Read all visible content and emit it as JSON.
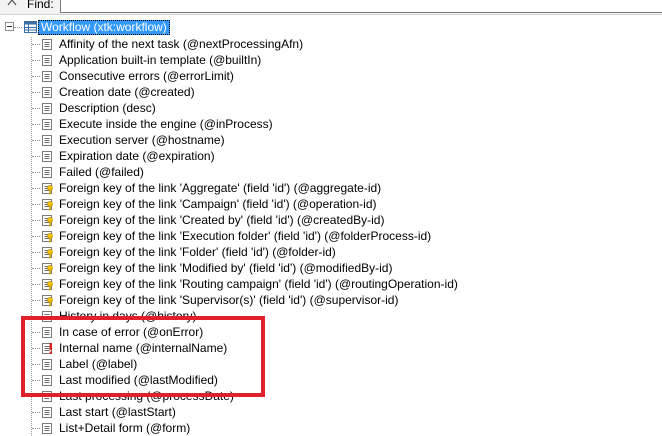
{
  "findbar": {
    "label": "Find:",
    "value": ""
  },
  "tree": {
    "root": {
      "label": "Workflow (xtk:workflow)",
      "expanded": true
    },
    "items": [
      {
        "label": "Affinity of the next task (@nextProcessingAfn)",
        "icon": "attribute-icon"
      },
      {
        "label": "Application built-in template (@builtIn)",
        "icon": "attribute-icon"
      },
      {
        "label": "Consecutive errors (@errorLimit)",
        "icon": "attribute-icon"
      },
      {
        "label": "Creation date (@created)",
        "icon": "attribute-icon"
      },
      {
        "label": "Description (desc)",
        "icon": "attribute-icon"
      },
      {
        "label": "Execute inside the engine (@inProcess)",
        "icon": "attribute-icon"
      },
      {
        "label": "Execution server (@hostname)",
        "icon": "attribute-icon"
      },
      {
        "label": "Expiration date (@expiration)",
        "icon": "attribute-icon"
      },
      {
        "label": "Failed (@failed)",
        "icon": "attribute-icon"
      },
      {
        "label": "Foreign key of the link 'Aggregate' (field 'id') (@aggregate-id)",
        "icon": "foreign-key-icon"
      },
      {
        "label": "Foreign key of the link 'Campaign' (field 'id') (@operation-id)",
        "icon": "foreign-key-icon"
      },
      {
        "label": "Foreign key of the link 'Created by' (field 'id') (@createdBy-id)",
        "icon": "foreign-key-icon"
      },
      {
        "label": "Foreign key of the link 'Execution folder' (field 'id') (@folderProcess-id)",
        "icon": "foreign-key-icon"
      },
      {
        "label": "Foreign key of the link 'Folder' (field 'id') (@folder-id)",
        "icon": "foreign-key-icon"
      },
      {
        "label": "Foreign key of the link 'Modified by' (field 'id') (@modifiedBy-id)",
        "icon": "foreign-key-icon"
      },
      {
        "label": "Foreign key of the link 'Routing campaign' (field 'id') (@routingOperation-id)",
        "icon": "foreign-key-icon"
      },
      {
        "label": "Foreign key of the link 'Supervisor(s)' (field 'id') (@supervisor-id)",
        "icon": "foreign-key-icon"
      },
      {
        "label": "History in days (@history)",
        "icon": "attribute-icon"
      },
      {
        "label": "In case of error (@onError)",
        "icon": "attribute-icon"
      },
      {
        "label": "Internal name (@internalName)",
        "icon": "required-attribute-icon"
      },
      {
        "label": "Label (@label)",
        "icon": "attribute-icon"
      },
      {
        "label": "Last modified (@lastModified)",
        "icon": "attribute-icon"
      },
      {
        "label": "Last processing (@processDate)",
        "icon": "attribute-icon"
      },
      {
        "label": "Last start (@lastStart)",
        "icon": "attribute-icon"
      },
      {
        "label": "List+Detail form (@form)",
        "icon": "attribute-icon"
      }
    ]
  },
  "colors": {
    "selection": "#3399ff",
    "highlight_border": "#e0202a"
  }
}
